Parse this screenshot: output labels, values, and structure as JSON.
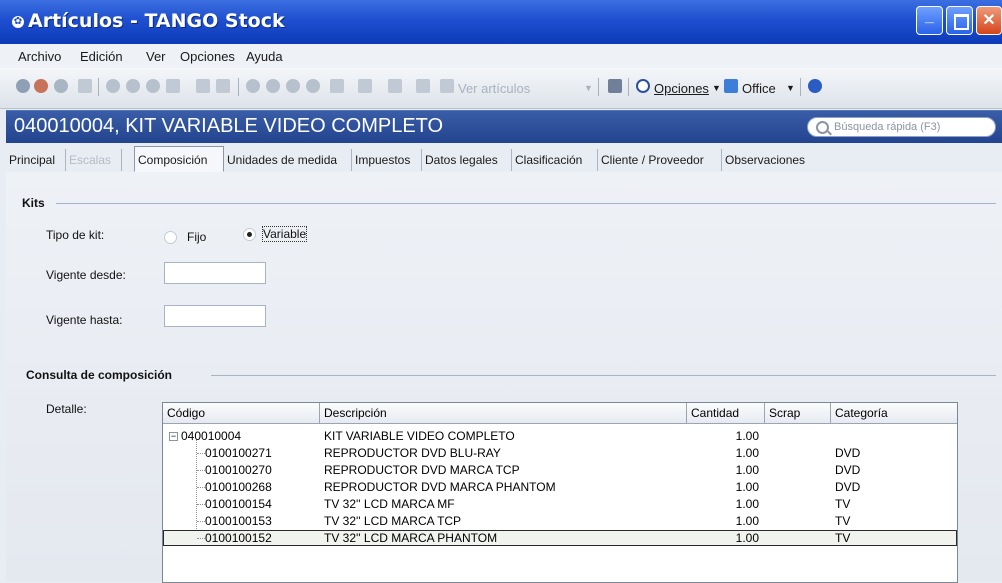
{
  "window": {
    "title": "Artículos - TANGO Stock"
  },
  "menu": [
    "Archivo",
    "Edición",
    "Ver",
    "Opciones",
    "Ayuda"
  ],
  "toolbar": {
    "ver_articulos": "Ver artículos",
    "opciones": "Opciones",
    "office": "Office"
  },
  "header": {
    "title": "040010004, KIT VARIABLE VIDEO COMPLETO",
    "search_placeholder": "Búsqueda rápida (F3)"
  },
  "tabs": [
    {
      "label": "Principal",
      "state": "normal"
    },
    {
      "label": "Escalas",
      "state": "disabled"
    },
    {
      "label": "Composición",
      "state": "active"
    },
    {
      "label": "Unidades de medida",
      "state": "normal"
    },
    {
      "label": "Impuestos",
      "state": "normal"
    },
    {
      "label": "Datos legales",
      "state": "normal"
    },
    {
      "label": "Clasificación",
      "state": "normal"
    },
    {
      "label": "Cliente / Proveedor",
      "state": "normal"
    },
    {
      "label": "Observaciones",
      "state": "normal"
    }
  ],
  "kits": {
    "section_title": "Kits",
    "tipo_label": "Tipo de kit:",
    "option_fijo": "Fijo",
    "option_variable": "Variable",
    "selected": "Variable",
    "vigente_desde_label": "Vigente desde:",
    "vigente_desde_value": "",
    "vigente_hasta_label": "Vigente hasta:",
    "vigente_hasta_value": ""
  },
  "consulta": {
    "section_title": "Consulta de composición",
    "detalle_label": "Detalle:",
    "columns": [
      "Código",
      "Descripción",
      "Cantidad",
      "Scrap",
      "Categoría"
    ],
    "rows": [
      {
        "codigo": "040010004",
        "descripcion": "KIT VARIABLE VIDEO COMPLETO",
        "cantidad": "1.00",
        "scrap": "",
        "categoria": "",
        "level": 0
      },
      {
        "codigo": "0100100271",
        "descripcion": "REPRODUCTOR DVD BLU-RAY",
        "cantidad": "1.00",
        "scrap": "",
        "categoria": "DVD",
        "level": 1
      },
      {
        "codigo": "0100100270",
        "descripcion": "REPRODUCTOR DVD MARCA TCP",
        "cantidad": "1.00",
        "scrap": "",
        "categoria": "DVD",
        "level": 1
      },
      {
        "codigo": "0100100268",
        "descripcion": "REPRODUCTOR DVD MARCA PHANTOM",
        "cantidad": "1.00",
        "scrap": "",
        "categoria": "DVD",
        "level": 1
      },
      {
        "codigo": "0100100154",
        "descripcion": "TV 32'' LCD MARCA MF",
        "cantidad": "1.00",
        "scrap": "",
        "categoria": "TV",
        "level": 1
      },
      {
        "codigo": "0100100153",
        "descripcion": "TV 32'' LCD MARCA TCP",
        "cantidad": "1.00",
        "scrap": "",
        "categoria": "TV",
        "level": 1
      },
      {
        "codigo": "0100100152",
        "descripcion": "TV 32'' LCD MARCA PHANTOM",
        "cantidad": "1.00",
        "scrap": "",
        "categoria": "TV",
        "level": 1,
        "selected": true
      }
    ]
  },
  "colors": {
    "title_bar": "#1f4fd0",
    "header_band": "#2d4f9b",
    "content_bg": "#e8ecf3"
  }
}
